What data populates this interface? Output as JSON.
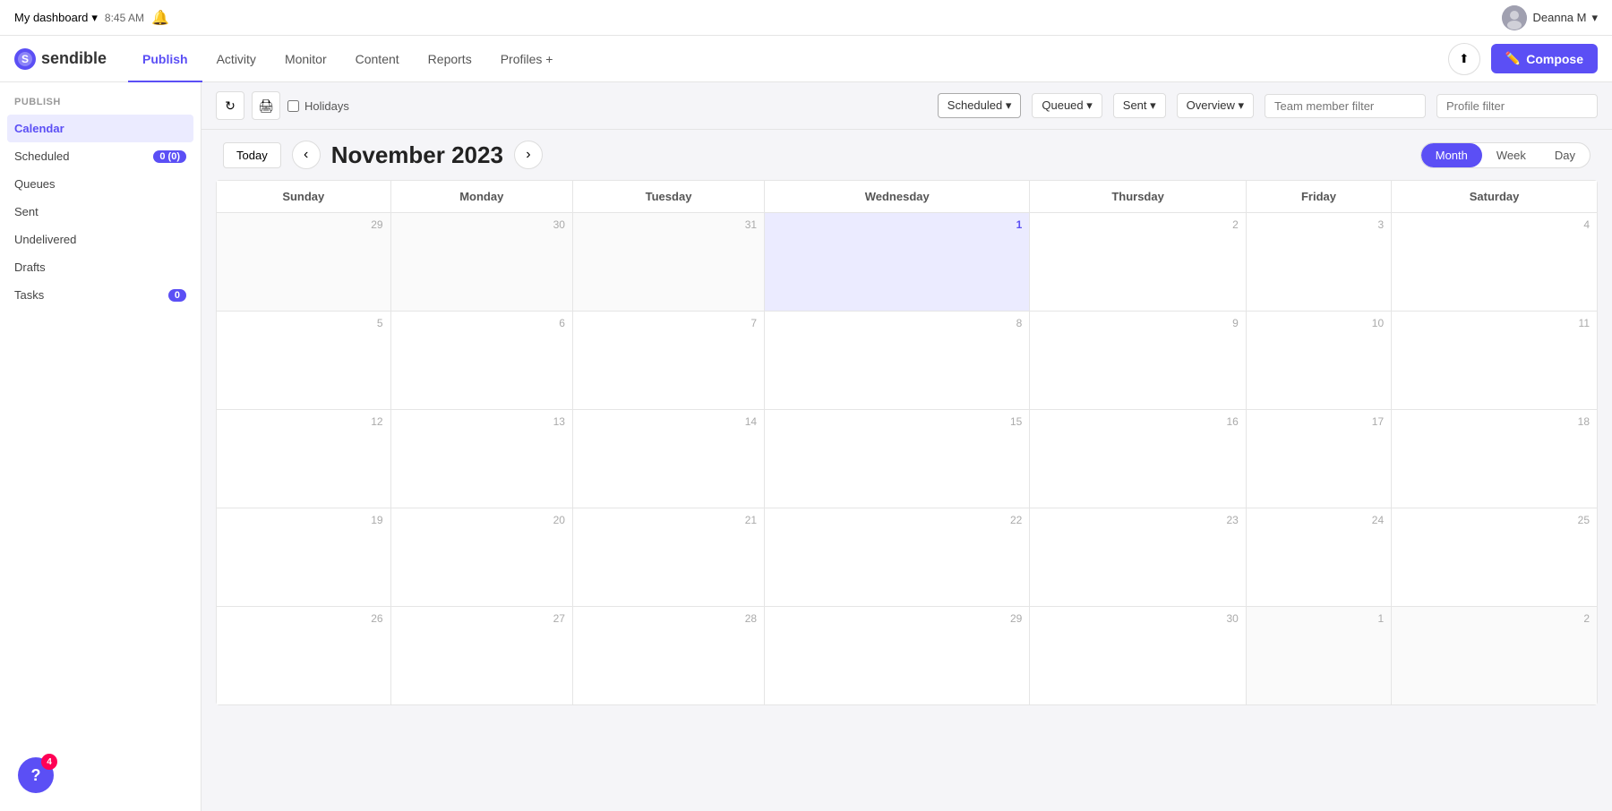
{
  "topbar": {
    "dashboard_label": "My dashboard",
    "time": "8:45 AM",
    "user_name": "Deanna M",
    "dropdown_arrow": "▾",
    "bell_icon": "🔔"
  },
  "navbar": {
    "logo_text": "sendible",
    "nav_items": [
      {
        "id": "publish",
        "label": "Publish",
        "active": true
      },
      {
        "id": "activity",
        "label": "Activity",
        "active": false
      },
      {
        "id": "monitor",
        "label": "Monitor",
        "active": false
      },
      {
        "id": "content",
        "label": "Content",
        "active": false
      },
      {
        "id": "reports",
        "label": "Reports",
        "active": false
      },
      {
        "id": "profiles",
        "label": "Profiles +",
        "active": false
      }
    ],
    "compose_label": "Compose",
    "upload_icon": "⬆"
  },
  "sidebar": {
    "section_title": "PUBLISH",
    "items": [
      {
        "id": "calendar",
        "label": "Calendar",
        "active": true,
        "badge": null
      },
      {
        "id": "scheduled",
        "label": "Scheduled",
        "active": false,
        "badge": "0 (0)"
      },
      {
        "id": "queues",
        "label": "Queues",
        "active": false,
        "badge": null
      },
      {
        "id": "sent",
        "label": "Sent",
        "active": false,
        "badge": null
      },
      {
        "id": "undelivered",
        "label": "Undelivered",
        "active": false,
        "badge": null
      },
      {
        "id": "drafts",
        "label": "Drafts",
        "active": false,
        "badge": null
      },
      {
        "id": "tasks",
        "label": "Tasks",
        "active": false,
        "badge": "0"
      }
    ]
  },
  "toolbar": {
    "refresh_icon": "↻",
    "print_icon": "🖨",
    "holidays_label": "Holidays",
    "filters": [
      {
        "id": "scheduled",
        "label": "Scheduled ▾"
      },
      {
        "id": "queued",
        "label": "Queued ▾"
      },
      {
        "id": "sent",
        "label": "Sent ▾"
      },
      {
        "id": "overview",
        "label": "Overview ▾"
      }
    ],
    "team_member_placeholder": "Team member filter",
    "profile_placeholder": "Profile filter"
  },
  "calendar": {
    "today_label": "Today",
    "month_title": "November 2023",
    "prev_icon": "‹",
    "next_icon": "›",
    "view_options": [
      {
        "id": "month",
        "label": "Month",
        "active": true
      },
      {
        "id": "week",
        "label": "Week",
        "active": false
      },
      {
        "id": "day",
        "label": "Day",
        "active": false
      }
    ],
    "days_of_week": [
      "Sunday",
      "Monday",
      "Tuesday",
      "Wednesday",
      "Thursday",
      "Friday",
      "Saturday"
    ],
    "weeks": [
      [
        {
          "num": "29",
          "other": true,
          "today": false
        },
        {
          "num": "30",
          "other": true,
          "today": false
        },
        {
          "num": "31",
          "other": true,
          "today": false
        },
        {
          "num": "1",
          "other": false,
          "today": true
        },
        {
          "num": "2",
          "other": false,
          "today": false
        },
        {
          "num": "3",
          "other": false,
          "today": false
        },
        {
          "num": "4",
          "other": false,
          "today": false
        }
      ],
      [
        {
          "num": "5",
          "other": false,
          "today": false
        },
        {
          "num": "6",
          "other": false,
          "today": false
        },
        {
          "num": "7",
          "other": false,
          "today": false
        },
        {
          "num": "8",
          "other": false,
          "today": false
        },
        {
          "num": "9",
          "other": false,
          "today": false
        },
        {
          "num": "10",
          "other": false,
          "today": false
        },
        {
          "num": "11",
          "other": false,
          "today": false
        }
      ],
      [
        {
          "num": "12",
          "other": false,
          "today": false
        },
        {
          "num": "13",
          "other": false,
          "today": false
        },
        {
          "num": "14",
          "other": false,
          "today": false
        },
        {
          "num": "15",
          "other": false,
          "today": false
        },
        {
          "num": "16",
          "other": false,
          "today": false
        },
        {
          "num": "17",
          "other": false,
          "today": false
        },
        {
          "num": "18",
          "other": false,
          "today": false
        }
      ],
      [
        {
          "num": "19",
          "other": false,
          "today": false
        },
        {
          "num": "20",
          "other": false,
          "today": false
        },
        {
          "num": "21",
          "other": false,
          "today": false
        },
        {
          "num": "22",
          "other": false,
          "today": false
        },
        {
          "num": "23",
          "other": false,
          "today": false
        },
        {
          "num": "24",
          "other": false,
          "today": false
        },
        {
          "num": "25",
          "other": false,
          "today": false
        }
      ],
      [
        {
          "num": "26",
          "other": false,
          "today": false
        },
        {
          "num": "27",
          "other": false,
          "today": false
        },
        {
          "num": "28",
          "other": false,
          "today": false
        },
        {
          "num": "29",
          "other": false,
          "today": false
        },
        {
          "num": "30",
          "other": false,
          "today": false
        },
        {
          "num": "1",
          "other": true,
          "today": false
        },
        {
          "num": "2",
          "other": true,
          "today": false
        }
      ]
    ]
  },
  "help": {
    "icon": "?",
    "badge": "4"
  },
  "colors": {
    "brand": "#5b4ff5",
    "today_bg": "#ebebff"
  }
}
